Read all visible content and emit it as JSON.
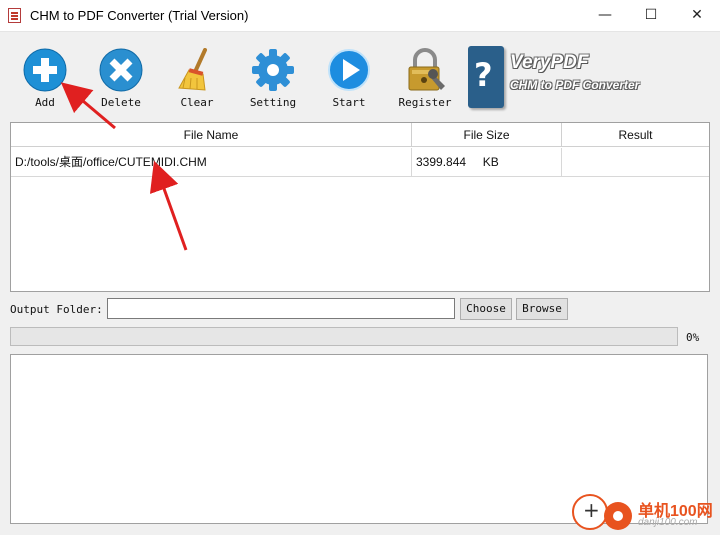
{
  "window": {
    "title": "CHM to PDF Converter (Trial Version)",
    "controls": {
      "minimize": "—",
      "maximize": "☐",
      "close": "✕"
    }
  },
  "toolbar": {
    "add_label": "Add",
    "delete_label": "Delete",
    "clear_label": "Clear",
    "setting_label": "Setting",
    "start_label": "Start",
    "register_label": "Register"
  },
  "brand": {
    "logo_glyph": "?",
    "name": "VeryPDF",
    "product": "CHM to PDF Converter"
  },
  "file_list": {
    "columns": [
      "File Name",
      "File Size",
      "Result"
    ],
    "rows": [
      {
        "file_name": "D:/tools/桌面/office/CUTEMIDI.CHM",
        "file_size": "3399.844     KB",
        "result": ""
      }
    ]
  },
  "output": {
    "label": "Output Folder:",
    "value": "",
    "choose_label": "Choose",
    "browse_label": "Browse"
  },
  "progress": {
    "value_percent": 0,
    "text": "0%"
  },
  "watermark": {
    "name": "单机100网",
    "url": "danji100.com"
  },
  "colors": {
    "add": "#1e90d6",
    "delete": "#2a8fd0",
    "setting": "#2e8fd6",
    "start": "#1d8de0",
    "annotation_arrow": "#e02020"
  },
  "icons": {
    "add": "plus-circle-icon",
    "delete": "x-circle-icon",
    "clear": "broom-icon",
    "setting": "gear-icon",
    "start": "play-icon",
    "register": "padlock-key-icon"
  }
}
